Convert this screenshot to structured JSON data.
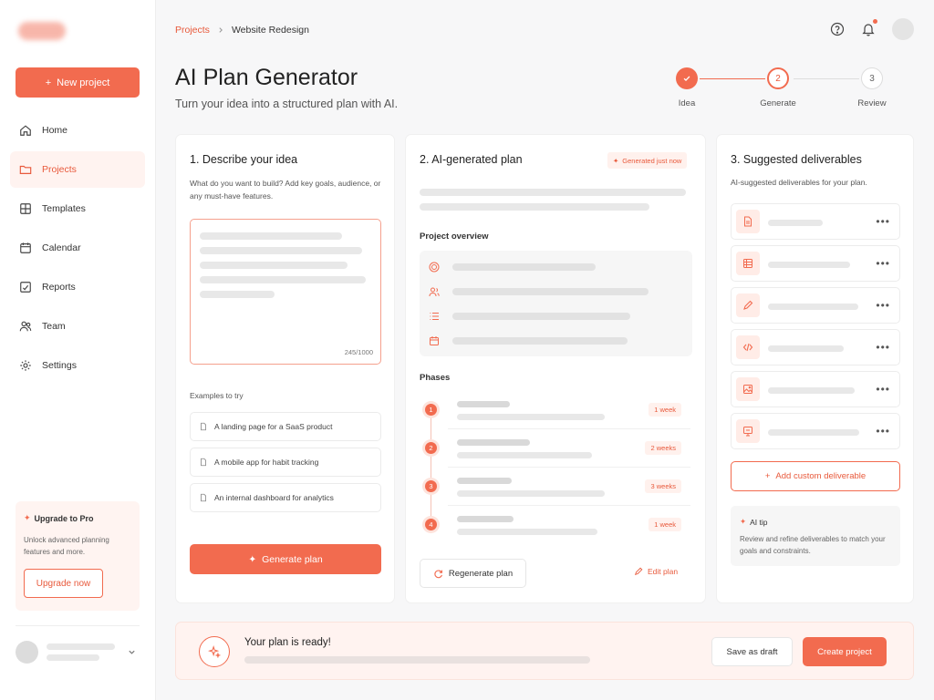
{
  "sidebar": {
    "new_project_label": "New project",
    "items": [
      {
        "label": "Home",
        "icon": "home-icon"
      },
      {
        "label": "Projects",
        "icon": "folder-icon",
        "active": true
      },
      {
        "label": "Templates",
        "icon": "template-icon"
      },
      {
        "label": "Calendar",
        "icon": "calendar-icon"
      },
      {
        "label": "Reports",
        "icon": "reports-icon"
      },
      {
        "label": "Team",
        "icon": "team-icon"
      },
      {
        "label": "Settings",
        "icon": "gear-icon"
      }
    ],
    "upgrade": {
      "title": "Upgrade to Pro",
      "description": "Unlock advanced planning features and more.",
      "button_label": "Upgrade now"
    }
  },
  "header": {
    "breadcrumb_root": "Projects",
    "breadcrumb_current": "Website Redesign",
    "title": "AI Plan Generator",
    "subtitle": "Turn your idea into a structured plan with AI."
  },
  "stepper": {
    "steps": [
      {
        "label": "Idea",
        "marker": "",
        "state": "done"
      },
      {
        "label": "Generate",
        "marker": "2",
        "state": "current"
      },
      {
        "label": "Review",
        "marker": "3",
        "state": "todo"
      }
    ]
  },
  "describe": {
    "title": "1. Describe your idea",
    "description": "What do you want to build? Add key goals, audience, or any must-have features.",
    "char_count": "245/1000",
    "examples_label": "Examples to try",
    "examples": [
      "A landing page for a SaaS product",
      "A mobile app for habit tracking",
      "An internal dashboard for analytics"
    ],
    "generate_label": "Generate plan"
  },
  "plan": {
    "title": "2. AI-generated plan",
    "badge": "Generated just now",
    "overview_label": "Project overview",
    "phases_label": "Phases",
    "phases": [
      {
        "number": "1",
        "duration": "1 week"
      },
      {
        "number": "2",
        "duration": "2 weeks"
      },
      {
        "number": "3",
        "duration": "3 weeks"
      },
      {
        "number": "4",
        "duration": "1 week"
      }
    ],
    "regenerate_label": "Regenerate plan",
    "edit_label": "Edit plan"
  },
  "deliverables": {
    "title": "3. Suggested deliverables",
    "description": "AI-suggested deliverables for your plan.",
    "icons": [
      "document-icon",
      "grid-icon",
      "pencil-icon",
      "code-icon",
      "image-icon",
      "presentation-icon"
    ],
    "add_label": "Add custom deliverable",
    "tip_title": "AI tip",
    "tip_text": "Review and refine deliverables to match your goals and constraints."
  },
  "bottom": {
    "ready_title": "Your plan is ready!",
    "draft_label": "Save as draft",
    "create_label": "Create project"
  },
  "colors": {
    "accent": "#f26b4f",
    "accent_light": "#fff3f0"
  }
}
